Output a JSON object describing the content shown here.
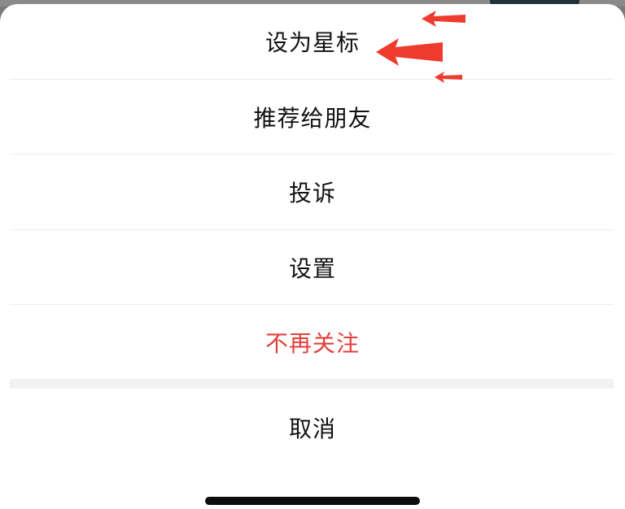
{
  "menu": {
    "items": [
      {
        "label": "设为星标"
      },
      {
        "label": "推荐给朋友"
      },
      {
        "label": "投诉"
      },
      {
        "label": "设置"
      },
      {
        "label": "不再关注"
      }
    ],
    "cancel_label": "取消"
  },
  "colors": {
    "danger": "#e2403b",
    "annotation_arrow": "#ef3b2d"
  }
}
